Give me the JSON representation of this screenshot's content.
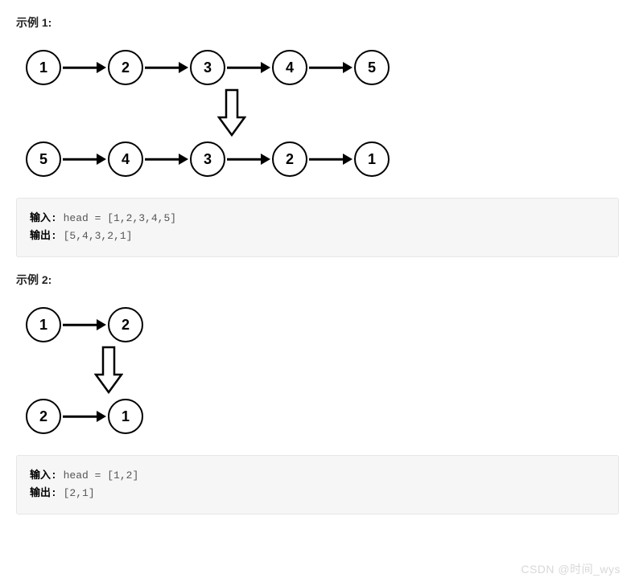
{
  "example1": {
    "title": "示例 1:",
    "before": [
      "1",
      "2",
      "3",
      "4",
      "5"
    ],
    "after": [
      "5",
      "4",
      "3",
      "2",
      "1"
    ],
    "input_label": "输入:",
    "input_value": "head = [1,2,3,4,5]",
    "output_label": "输出:",
    "output_value": "[5,4,3,2,1]"
  },
  "example2": {
    "title": "示例 2:",
    "before": [
      "1",
      "2"
    ],
    "after": [
      "2",
      "1"
    ],
    "input_label": "输入:",
    "input_value": "head = [1,2]",
    "output_label": "输出:",
    "output_value": "[2,1]"
  },
  "watermark": "CSDN @时间_wys",
  "chart_data": [
    {
      "type": "linked-list-diagram",
      "title": "示例 1",
      "before": [
        1,
        2,
        3,
        4,
        5
      ],
      "after": [
        5,
        4,
        3,
        2,
        1
      ],
      "operation": "reverse"
    },
    {
      "type": "linked-list-diagram",
      "title": "示例 2",
      "before": [
        1,
        2
      ],
      "after": [
        2,
        1
      ],
      "operation": "reverse"
    }
  ]
}
